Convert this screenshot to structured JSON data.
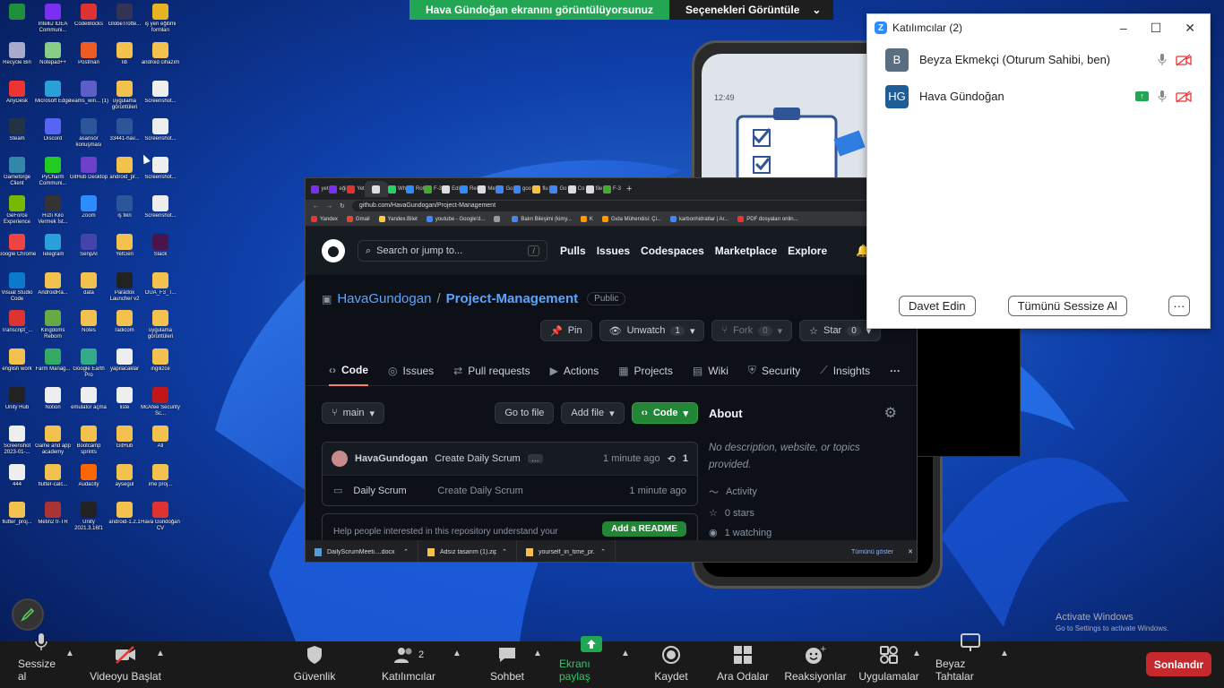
{
  "share_banner": {
    "text": "Hava Gündoğan ekranını görüntülüyorsunuz",
    "options": "Seçenekleri Görüntüle"
  },
  "desktop_icons": [
    {
      "label": "",
      "color": "#1e8f3c"
    },
    {
      "label": "IntelliJ IDEA Communi...",
      "color": "#7b2ff2"
    },
    {
      "label": "CodeBlocks",
      "color": "#d33"
    },
    {
      "label": "GlobeTrotte...",
      "color": "#335"
    },
    {
      "label": "iş yeri eğitimi formları",
      "color": "#e6b422"
    },
    {
      "label": "Recycle Bin",
      "color": "#aac"
    },
    {
      "label": "Notepad++",
      "color": "#8c8"
    },
    {
      "label": "Postman",
      "color": "#ef5b25"
    },
    {
      "label": "lib",
      "color": "#f2c14e"
    },
    {
      "label": "android cihazım",
      "color": "#f2c14e"
    },
    {
      "label": "AnyDesk",
      "color": "#e33"
    },
    {
      "label": "Microsoft Edge",
      "color": "#2aa0d8"
    },
    {
      "label": "Teams_win... (1)",
      "color": "#5b5fc7"
    },
    {
      "label": "uygulama görüntüleri",
      "color": "#f2c14e"
    },
    {
      "label": "Screenshot...",
      "color": "#eee"
    },
    {
      "label": "Steam",
      "color": "#234"
    },
    {
      "label": "Discord",
      "color": "#5865f2"
    },
    {
      "label": "asansör konuşması",
      "color": "#2b579a"
    },
    {
      "label": "33441-hav...",
      "color": "#2b579a"
    },
    {
      "label": "Screenshot...",
      "color": "#eee"
    },
    {
      "label": "Gameforge Client",
      "color": "#38a"
    },
    {
      "label": "PyCharm Communi...",
      "color": "#2c2"
    },
    {
      "label": "GitHub Desktop",
      "color": "#6e40c9"
    },
    {
      "label": "android_pr...",
      "color": "#f2c14e"
    },
    {
      "label": "Screenshot...",
      "color": "#eee"
    },
    {
      "label": "GeForce Experience",
      "color": "#76b900"
    },
    {
      "label": "Hızlı Kilo Vermek İst...",
      "color": "#333"
    },
    {
      "label": "Zoom",
      "color": "#2d8cff"
    },
    {
      "label": "iş fikri",
      "color": "#2b579a"
    },
    {
      "label": "Screenshot...",
      "color": "#eee"
    },
    {
      "label": "Google Chrome",
      "color": "#e44"
    },
    {
      "label": "Telegram",
      "color": "#2aa0d8"
    },
    {
      "label": "SenpAI",
      "color": "#44a"
    },
    {
      "label": "YetGen",
      "color": "#f2c14e"
    },
    {
      "label": "Slack",
      "color": "#4a154b"
    },
    {
      "label": "Visual Studio Code",
      "color": "#0a7acc"
    },
    {
      "label": "AndroidRa...",
      "color": "#f2c14e"
    },
    {
      "label": "data",
      "color": "#f2c14e"
    },
    {
      "label": "Paradox Launcher v2",
      "color": "#222"
    },
    {
      "label": "OUA_F3_T...",
      "color": "#f2c14e"
    },
    {
      "label": "Transcript_...",
      "color": "#d33"
    },
    {
      "label": "Kingdoms Reborn",
      "color": "#6a4"
    },
    {
      "label": "Notes",
      "color": "#f2c14e"
    },
    {
      "label": "radicom",
      "color": "#f2c14e"
    },
    {
      "label": "uygulama görüntüleri",
      "color": "#f2c14e"
    },
    {
      "label": "english work",
      "color": "#f2c14e"
    },
    {
      "label": "Farm Manag...",
      "color": "#3a6"
    },
    {
      "label": "Google Earth Pro",
      "color": "#3a8"
    },
    {
      "label": "yapılacaklar",
      "color": "#eee"
    },
    {
      "label": "ingilizce",
      "color": "#f2c14e"
    },
    {
      "label": "Unity Hub",
      "color": "#222"
    },
    {
      "label": "Notion",
      "color": "#eee"
    },
    {
      "label": "emulator açma",
      "color": "#eee"
    },
    {
      "label": "liste",
      "color": "#eee"
    },
    {
      "label": "McAfee Security Sc...",
      "color": "#c01818"
    },
    {
      "label": "Screenshot 2023-01-...",
      "color": "#eee"
    },
    {
      "label": "Game and app academy",
      "color": "#f2c14e"
    },
    {
      "label": "Bootcamp sprints",
      "color": "#f2c14e"
    },
    {
      "label": "GitHub",
      "color": "#f2c14e"
    },
    {
      "label": "All",
      "color": "#f2c14e"
    },
    {
      "label": "444",
      "color": "#eee"
    },
    {
      "label": "flutter-calc...",
      "color": "#f2c14e"
    },
    {
      "label": "Audacity",
      "color": "#f60"
    },
    {
      "label": "aysegül",
      "color": "#f2c14e"
    },
    {
      "label": "ime proj...",
      "color": "#f2c14e"
    },
    {
      "label": "flutter_proj...",
      "color": "#f2c14e"
    },
    {
      "label": "Metin2 tr-TR",
      "color": "#a33"
    },
    {
      "label": "Unity 2021.3.16f1",
      "color": "#222"
    },
    {
      "label": "android-1.2.1",
      "color": "#f2c14e"
    },
    {
      "label": "Hava Gündoğan CV",
      "color": "#d33"
    }
  ],
  "browser": {
    "tabs": [
      "yet",
      "eği",
      "Yet",
      "",
      "Wh",
      "Rol",
      "F-3",
      "Edi",
      "Rei",
      "Me",
      "Go",
      "goo",
      "flu",
      "Go",
      "Co",
      "file",
      "F-3"
    ],
    "url": "github.com/HavaGundogan/Project-Management",
    "bookmarks": [
      "Yandex",
      "Gmail",
      "Yandex.Bilet",
      "youtube - Google'd...",
      "",
      "Balın Bileşimi (kimy...",
      "K",
      "Gıda Mühendisi: Çi...",
      "karbonhidratlar | Ar...",
      "PDF dosyaları onlin..."
    ],
    "downloads": [
      "DailyScrumMeeti....docx",
      "Adsız tasarım (1).zip",
      "yourself_in_time_pr....zip"
    ],
    "show_all": "Tümünü göster"
  },
  "github": {
    "search_placeholder": "Search or jump to...",
    "nav": [
      "Pulls",
      "Issues",
      "Codespaces",
      "Marketplace",
      "Explore"
    ],
    "owner": "HavaGundogan",
    "separator": "/",
    "repo": "Project-Management",
    "visibility": "Public",
    "pin": "Pin",
    "unwatch": "Unwatch",
    "unwatch_count": "1",
    "fork": "Fork",
    "fork_count": "0",
    "star": "Star",
    "star_count": "0",
    "tabs": [
      "Code",
      "Issues",
      "Pull requests",
      "Actions",
      "Projects",
      "Wiki",
      "Security",
      "Insights"
    ],
    "branch": "main",
    "go_to_file": "Go to file",
    "add_file": "Add file",
    "code_btn": "Code",
    "commit_author": "HavaGundogan",
    "commit_msg": "Create Daily Scrum",
    "commit_time": "1 minute ago",
    "commit_count": "1",
    "file_name": "Daily Scrum",
    "file_msg": "Create Daily Scrum",
    "file_time": "1 minute ago",
    "readme_text": "Help people interested in this repository understand your",
    "readme_btn": "Add a README",
    "about_title": "About",
    "about_desc": "No description, website, or topics provided.",
    "activity": "Activity",
    "stars": "0 stars",
    "watching": "1 watching"
  },
  "phone": {
    "time": "12:49"
  },
  "participants": {
    "title": "Katılımcılar (2)",
    "list": [
      {
        "initials": "B",
        "name": "Beyza Ekmekçi (Oturum Sahibi, ben)",
        "color": "#5a6e82"
      },
      {
        "initials": "HG",
        "name": "Hava Gündoğan",
        "color": "#1e5d95"
      }
    ],
    "invite": "Davet Edin",
    "mute_all": "Tümünü Sessize Al",
    "more": "···"
  },
  "toolbar": {
    "mute": "Sessize al",
    "video": "Videoyu Başlat",
    "security": "Güvenlik",
    "participants": "Katılımcılar",
    "participants_count": "2",
    "chat": "Sohbet",
    "share": "Ekranı paylaş",
    "record": "Kaydet",
    "breakout": "Ara Odalar",
    "reactions": "Reaksiyonlar",
    "apps": "Uygulamalar",
    "whiteboards": "Beyaz Tahtalar",
    "end": "Sonlandır"
  },
  "activate": {
    "title": "Activate Windows",
    "sub": "Go to Settings to activate Windows."
  }
}
